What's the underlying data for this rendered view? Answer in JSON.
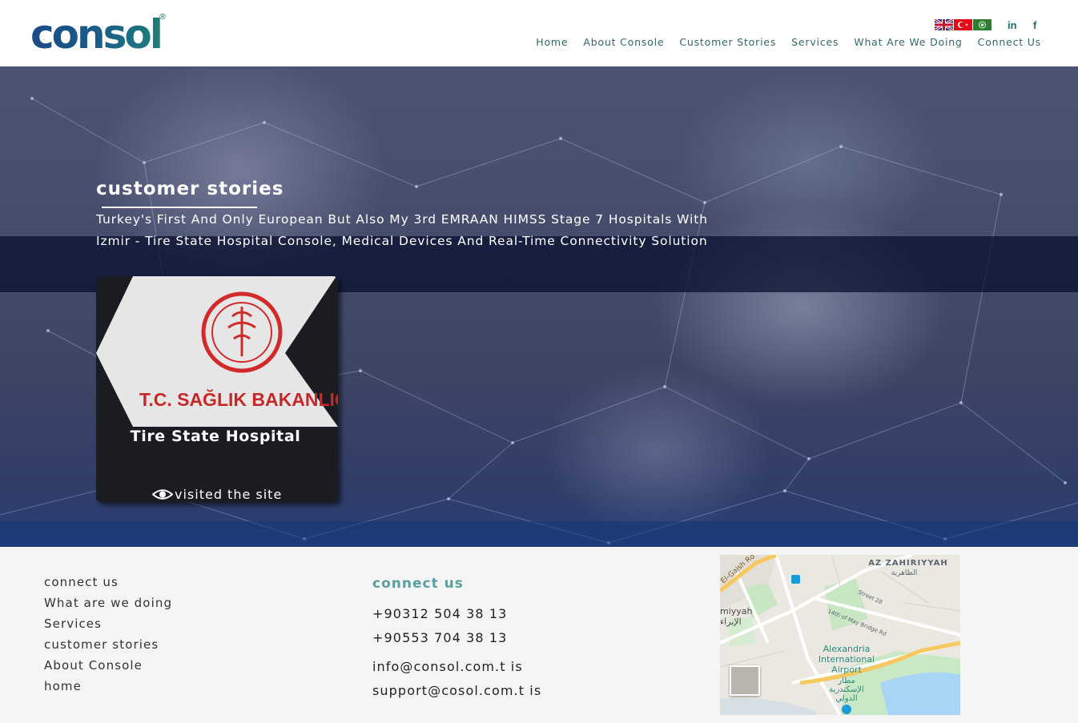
{
  "brand": {
    "logo_text": "consol",
    "registered_mark": "®"
  },
  "languages": [
    {
      "name": "english-flag"
    },
    {
      "name": "turkish-flag"
    },
    {
      "name": "arabic-flag"
    }
  ],
  "social": {
    "linkedin": "in",
    "facebook": "f"
  },
  "nav": {
    "items": [
      "Home",
      "About Console",
      "Customer Stories",
      "Services",
      "What Are We Doing",
      "Connect Us"
    ]
  },
  "hero": {
    "title": "customer stories",
    "description_line1": "Turkey's First And Only European But Also My 3rd EMRAAN HIMSS Stage 7 Hospitals With",
    "description_line2": "Izmir - Tire State Hospital Console, Medical Devices And Real-Time Connectivity Solution"
  },
  "card": {
    "logo_text": "T.C. SAĞLIK BAKANLIĞI",
    "title": "Tire State Hospital",
    "link_label": "visited the site"
  },
  "footer": {
    "links": [
      "connect us",
      "What are we doing",
      "Services",
      "customer stories",
      "About Console",
      "home"
    ],
    "contact_heading": "connect us",
    "phone1": "+90312 504 38 13",
    "phone2": "+90553 704 38 13",
    "email1": "info@consol.com.t is",
    "email2": "support@cosol.com.t is"
  },
  "map": {
    "district": "AZ ZAHIRIYYAH",
    "district_ar": "الظاهرية",
    "street_1": "El-Gaish Rd",
    "street_2": "Street 28",
    "street_3": "14th of May Bridge Rd",
    "area_1": "miyyah",
    "area_1_ar": "الإبراء",
    "airport_line1": "Alexandria",
    "airport_line2": "International",
    "airport_line3": "Airport",
    "airport_ar1": "مطار",
    "airport_ar2": "الإسكندرية",
    "airport_ar3": "الدولي"
  },
  "colors": {
    "nav_text": "#33666e",
    "accent_teal": "#5a9fa0",
    "logo_blue": "#1a4a8a",
    "logo_teal": "#1d7f7a",
    "hero_band": "#060e2c",
    "card_bg": "#1b1c21",
    "footer_bg": "#f5f5f5"
  }
}
